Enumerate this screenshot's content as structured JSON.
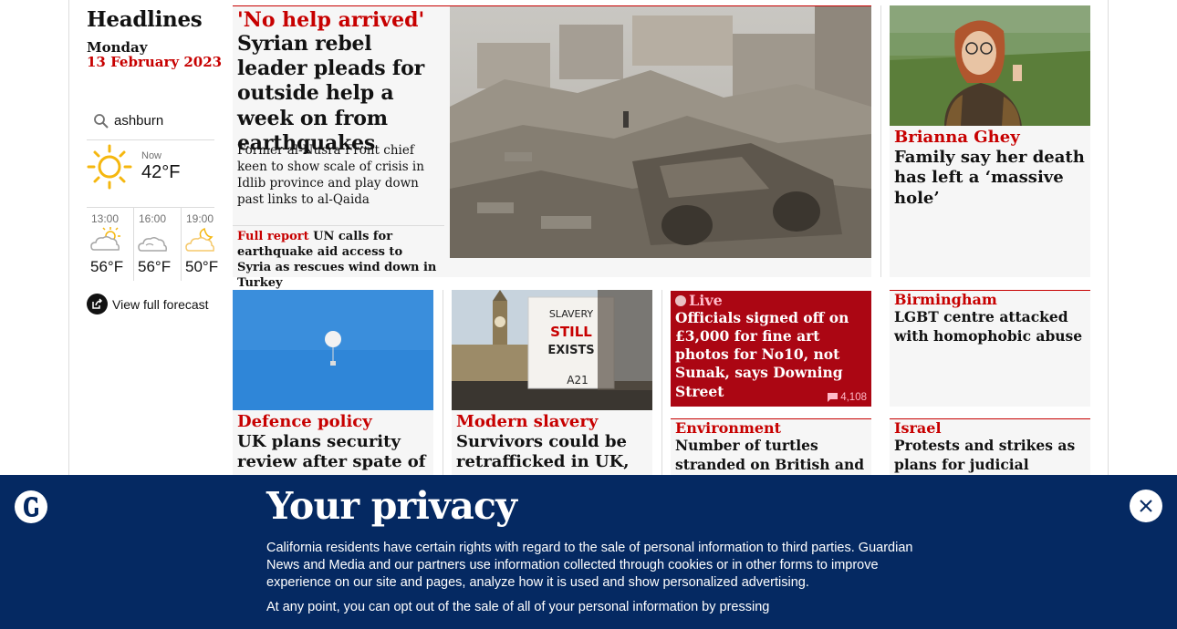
{
  "rail": {
    "title": "Headlines",
    "day": "Monday",
    "date": "13 February 2023",
    "search_value": "ashburn",
    "weather": {
      "now_label": "Now",
      "now_temp": "42°F",
      "now_icon": "sun-icon",
      "forecast": [
        {
          "time": "13:00",
          "temp": "56°F",
          "icon": "sun-cloud-icon"
        },
        {
          "time": "16:00",
          "temp": "56°F",
          "icon": "cloud-icon"
        },
        {
          "time": "19:00",
          "temp": "50°F",
          "icon": "moon-cloud-icon"
        }
      ],
      "full_forecast_label": "View full forecast"
    }
  },
  "main_story": {
    "kicker": "'No help arrived'",
    "headline": "Syrian rebel leader pleads for outside help a week on from earthquakes",
    "standfirst": "Former al-Nusra Front chief keen to show scale of crisis in Idlib province and play down past links to al-Qaida",
    "sublink_kicker": "Full report",
    "sublink_text": "UN calls for earthquake aid access to Syria as rescues wind down in Turkey"
  },
  "side_story": {
    "kicker": "Brianna Ghey",
    "headline": "Family say her death has left a ‘massive hole’"
  },
  "row2": [
    {
      "kicker": "Defence policy",
      "headline": "UK plans security review after spate of"
    },
    {
      "kicker": "Modern slavery",
      "headline": "Survivors could be retrafficked in UK,"
    },
    {
      "live_label": "Live",
      "headline": "Officials signed off on £3,000 for fine art photos for No10, not Sunak, says Downing Street",
      "comments": "4,108"
    },
    {
      "kicker": "Birmingham",
      "headline": "LGBT centre attacked with homophobic abuse"
    }
  ],
  "row3": [
    {
      "kicker": "Environment",
      "headline": "Number of turtles stranded on British and Irish coast"
    },
    {
      "kicker": "Israel",
      "headline": "Protests and strikes as plans for judicial overhaul"
    }
  ],
  "sign_text": [
    "SLAVERY",
    "STILL",
    "EXISTS"
  ],
  "privacy": {
    "title": "Your privacy",
    "paragraph1": "California residents have certain rights with regard to the sale of personal information to third parties. Guardian News and Media and our partners use information collected through cookies or in other forms to improve experience on our site and pages, analyze how it is used and show personalized advertising.",
    "paragraph2": "At any point, you can opt out of the sale of all of your personal information by pressing"
  },
  "colors": {
    "brand_red": "#c70000",
    "brand_blue": "#052962",
    "card_bg": "#f6f6f6"
  }
}
